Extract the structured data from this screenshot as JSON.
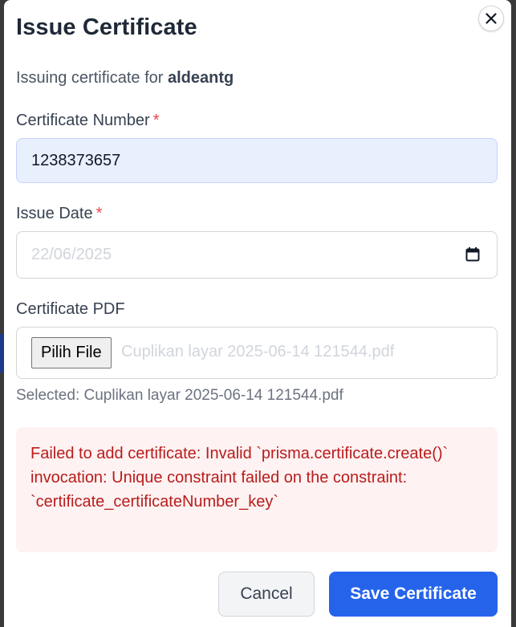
{
  "modal": {
    "title": "Issue Certificate",
    "subtitle_prefix": "Issuing certificate for ",
    "subtitle_user": "aldeantg",
    "close_icon": "close-icon"
  },
  "fields": {
    "certificate_number": {
      "label": "Certificate Number",
      "required_mark": "*",
      "value": "1238373657"
    },
    "issue_date": {
      "label": "Issue Date",
      "required_mark": "*",
      "value": "22/06/2025",
      "icon": "calendar-icon"
    },
    "certificate_pdf": {
      "label": "Certificate PDF",
      "button_label": "Pilih File",
      "file_name": "Cuplikan layar 2025-06-14 121544.pdf",
      "selected_text": "Selected: Cuplikan layar 2025-06-14 121544.pdf"
    }
  },
  "error": {
    "message": "Failed to add certificate: Invalid `prisma.certificate.create()` invocation: Unique constraint failed on the constraint: `certificate_certificateNumber_key`"
  },
  "actions": {
    "cancel_label": "Cancel",
    "save_label": "Save Certificate"
  },
  "colors": {
    "primary": "#2563eb",
    "error_text": "#b91c1c",
    "error_bg": "#fef2f2",
    "required": "#ef4444",
    "autofill_bg": "#e8f0fe"
  }
}
